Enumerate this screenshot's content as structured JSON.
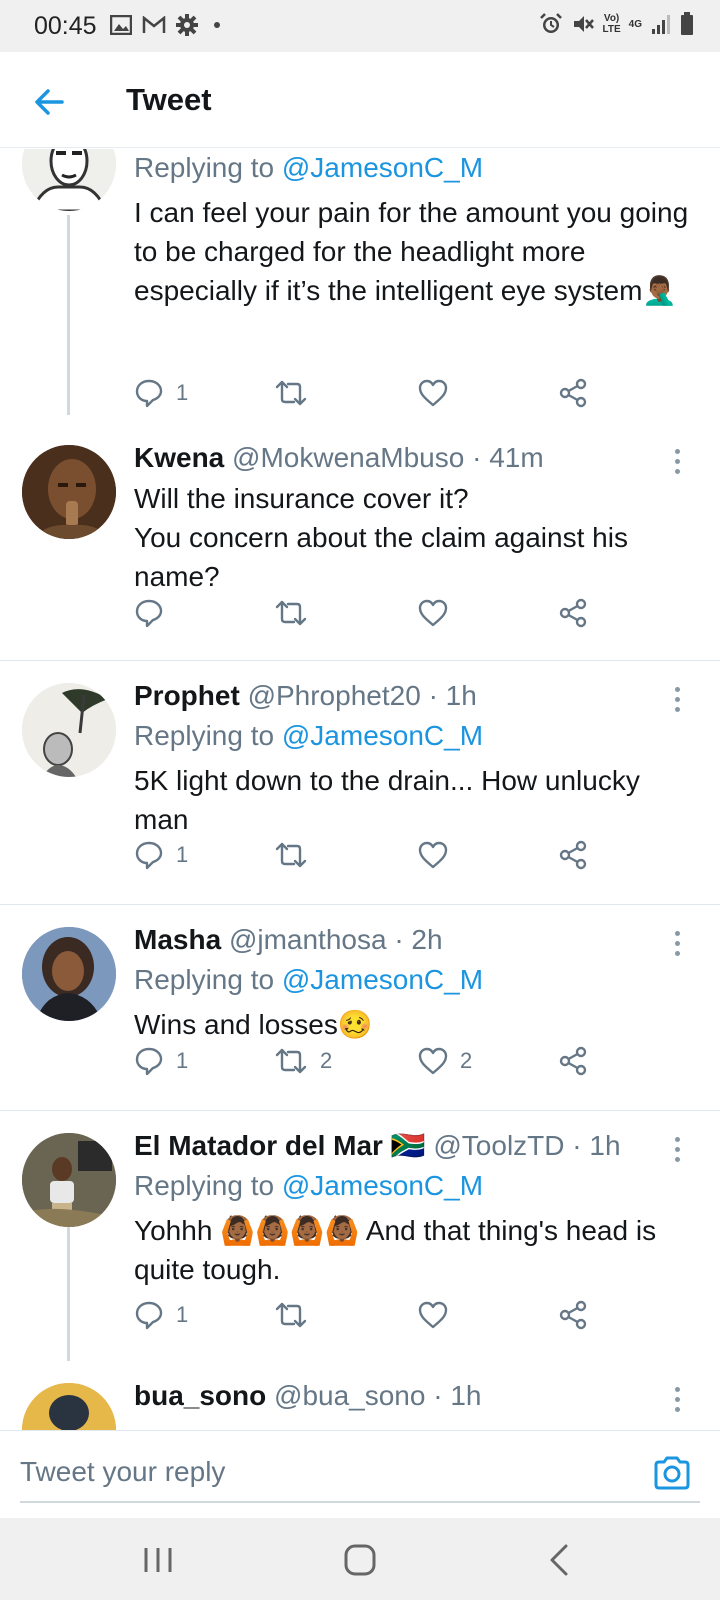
{
  "status_bar": {
    "time": "00:45",
    "volte": "Vo)\nLTE",
    "network": "4G"
  },
  "header": {
    "title": "Tweet"
  },
  "tweets": [
    {
      "replying_prefix": "Replying to ",
      "replying_handle": "@JamesonC_M",
      "text": "I can feel your pain for the amount you going to be charged for the headlight more especially if it’s the intelligent eye system🤦🏾‍♂️",
      "replies": "1",
      "retweets": "",
      "likes": ""
    },
    {
      "name": "Kwena",
      "handle": "@MokwenaMbuso",
      "time": "· 41m",
      "text_line1": "Will the insurance cover it?",
      "text_line2": "You concern about the claim against his name?",
      "replies": "",
      "retweets": "",
      "likes": ""
    },
    {
      "name": "Prophet",
      "handle": "@Phrophet20",
      "time": "· 1h",
      "replying_prefix": "Replying to ",
      "replying_handle": "@JamesonC_M",
      "text": "5K light down to the drain... How unlucky man",
      "replies": "1",
      "retweets": "",
      "likes": ""
    },
    {
      "name": "Masha",
      "handle": "@jmanthosa",
      "time": "· 2h",
      "replying_prefix": "Replying to ",
      "replying_handle": "@JamesonC_M",
      "text": "Wins and losses🥴",
      "replies": "1",
      "retweets": "2",
      "likes": "2"
    },
    {
      "name": "El Matador del Mar",
      "flag": "🇿🇦",
      "handle": "@ToolzTD",
      "time": "· 1h",
      "replying_prefix": "Replying to ",
      "replying_handle": "@JamesonC_M",
      "text": "Yohhh 🙆🏾🙆🏾🙆🏾🙆🏾 And that thing's head is quite tough.",
      "replies": "1",
      "retweets": "",
      "likes": ""
    },
    {
      "name": "bua_sono",
      "handle": "@bua_sono",
      "time": "· 1h"
    }
  ],
  "reply_bar": {
    "placeholder": "Tweet your reply"
  },
  "colors": {
    "accent": "#1b95e0",
    "muted": "#657786",
    "text": "#14171a"
  }
}
